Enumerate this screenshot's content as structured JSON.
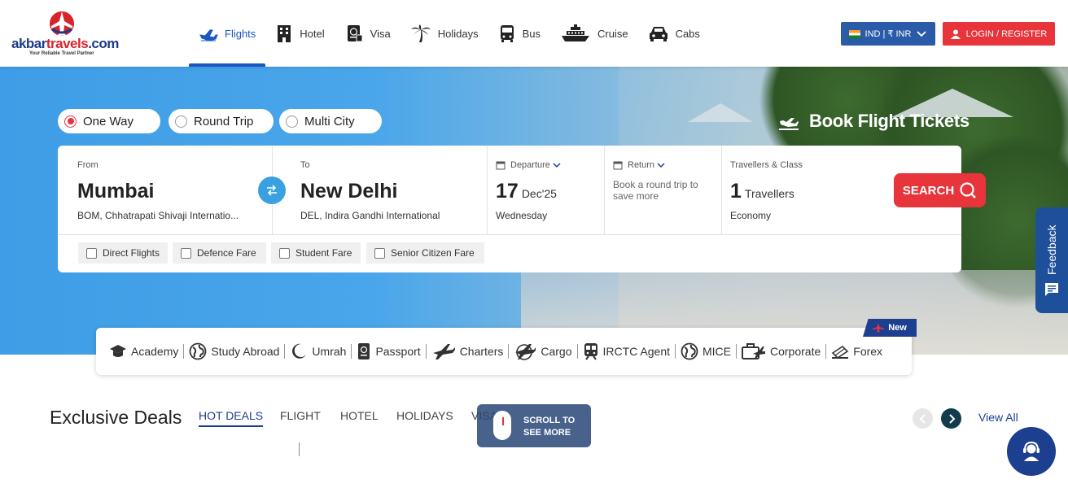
{
  "brand": {
    "name_part1": "akbar",
    "name_part2": "travels",
    "name_part3": ".com",
    "tagline": "Your Reliable Travel Partner"
  },
  "nav": [
    {
      "label": "Flights",
      "icon": "plane-icon",
      "active": true
    },
    {
      "label": "Hotel",
      "icon": "hotel-icon",
      "active": false
    },
    {
      "label": "Visa",
      "icon": "passport-icon",
      "active": false
    },
    {
      "label": "Holidays",
      "icon": "palm-tree-icon",
      "active": false
    },
    {
      "label": "Bus",
      "icon": "bus-icon",
      "active": false
    },
    {
      "label": "Cruise",
      "icon": "ship-icon",
      "active": false
    },
    {
      "label": "Cabs",
      "icon": "car-icon",
      "active": false
    }
  ],
  "header": {
    "currency": "IND | ₹ INR",
    "login": "LOGIN / REGISTER"
  },
  "trip_types": [
    {
      "label": "One Way",
      "selected": true
    },
    {
      "label": "Round Trip",
      "selected": false
    },
    {
      "label": "Multi City",
      "selected": false
    }
  ],
  "hero": {
    "title": "Book Flight Tickets"
  },
  "search": {
    "from_label": "From",
    "from_city": "Mumbai",
    "from_airport": "BOM, Chhatrapati Shivaji Internatio...",
    "to_label": "To",
    "to_city": "New Delhi",
    "to_airport": "DEL, Indira Gandhi International",
    "departure_label": "Departure",
    "departure_day": "17",
    "departure_month": "Dec'25",
    "departure_weekday": "Wednesday",
    "return_label": "Return",
    "return_hint": "Book a round trip to save more",
    "travellers_label": "Travellers & Class",
    "travellers_count": "1",
    "travellers_unit": "Travellers",
    "travel_class": "Economy",
    "search_button": "SEARCH"
  },
  "fare_options": [
    "Direct Flights",
    "Defence Fare",
    "Student Fare",
    "Senior Citizen Fare"
  ],
  "feedback": "Feedback",
  "services": [
    {
      "label": "Academy",
      "icon": "graduation-cap-icon"
    },
    {
      "label": "Study Abroad",
      "icon": "globe-icon"
    },
    {
      "label": "Umrah",
      "icon": "crescent-moon-icon"
    },
    {
      "label": "Passport",
      "icon": "passport-icon"
    },
    {
      "label": "Charters",
      "icon": "plane-icon"
    },
    {
      "label": "Cargo",
      "icon": "cargo-plane-icon"
    },
    {
      "label": "IRCTC Agent",
      "icon": "train-icon"
    },
    {
      "label": "MICE",
      "icon": "globe-icon"
    },
    {
      "label": "Corporate",
      "icon": "briefcase-plane-icon"
    },
    {
      "label": "Forex",
      "icon": "currency-icon"
    }
  ],
  "new_badge": "New",
  "deals": {
    "title": "Exclusive Deals",
    "tabs": [
      {
        "label": "HOT DEALS",
        "active": true
      },
      {
        "label": "FLIGHT",
        "active": false
      },
      {
        "label": "HOTEL",
        "active": false
      },
      {
        "label": "HOLIDAYS",
        "active": false
      },
      {
        "label": "VISA",
        "active": false
      }
    ],
    "view_all": "View All"
  },
  "scroll_hint": {
    "line1": "SCROLL TO",
    "line2": "SEE MORE"
  },
  "colors": {
    "primary": "#1d3f8f",
    "accent_red": "#e8343b",
    "nav_active": "#1a56c4",
    "hero_blue": "#3e9de6"
  }
}
